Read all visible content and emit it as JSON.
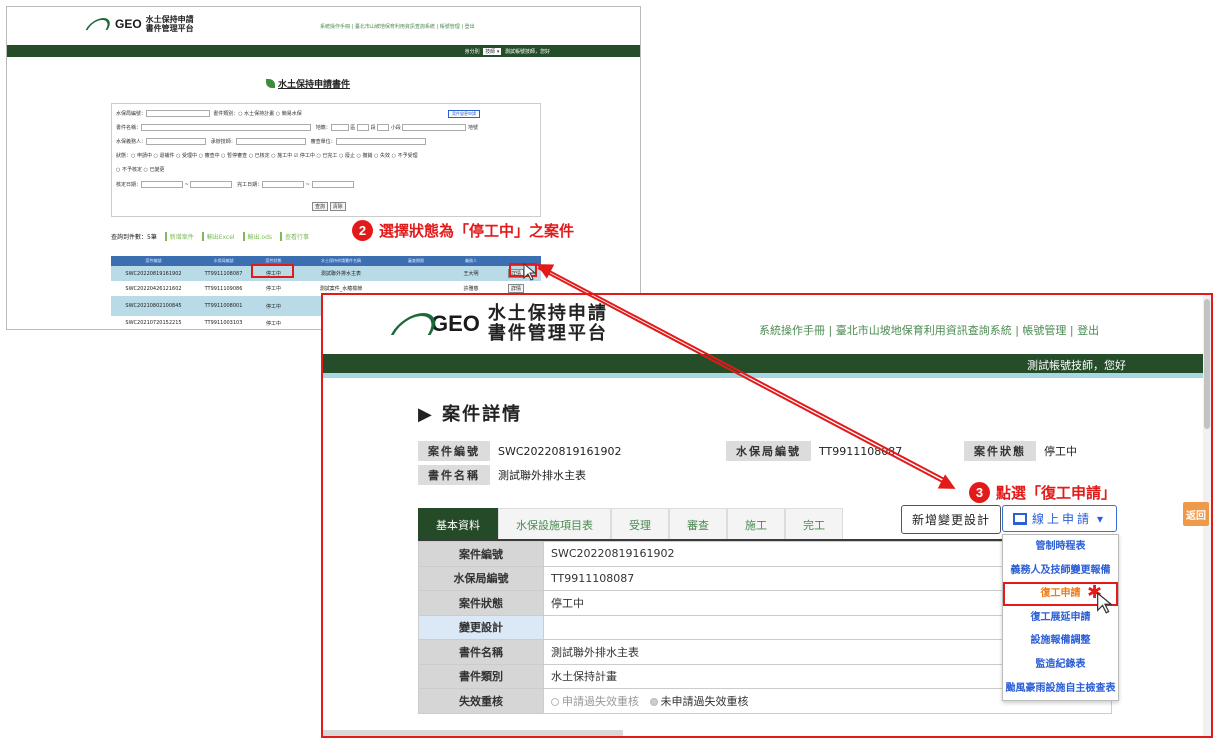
{
  "colors": {
    "annotation_red": "#e21a1a",
    "header_green": "#264d2a",
    "link_blue": "#2b5fd6",
    "accent_orange": "#ef7c14"
  },
  "bg": {
    "logo_text": "GEO",
    "logo_title_1": "水土保持申請",
    "logo_title_2": "書件管理平台",
    "top_links": "系統操作手冊 | 臺北市山坡地保育利用資訊查詢系統 | 帳號管理 | 登出",
    "role_label": "身分別",
    "role_value": "技師",
    "greeting": "測試帳號技師，您好",
    "page_title": "水土保持申請書件",
    "form": {
      "row1": "水保局編號：",
      "row1b": "書件類別：○ 水土保持計畫 ○ 簡易水保",
      "row1c": "案件變更申請",
      "row2": "書件名稱：",
      "row2b": "地籍：",
      "row2c": "區",
      "row2d": "段",
      "row2e": "小段",
      "row2f": "地號",
      "row3": "水保義務人：",
      "row3b": "承辦技師：",
      "row3c": "審查單位：",
      "row4": "狀態：○ 申請中 ○ 退補件 ○ 受理中 ○ 審查中 ○ 暫停審查 ○ 已核定 ○ 施工中 ☑ 停工中 ○ 已完工 ○ 廢止 ○ 撤銷 ○ 失效 ○ 不予受理",
      "row5": "○ 不予核定 ○ 已變更",
      "row6": "核定日期：",
      "row6b": "完工日期：",
      "query": "查詢",
      "clear": "清除"
    },
    "result_count": "查詢到件數：5筆",
    "toolbar": [
      "新增案件",
      "輸出Excel",
      "輸出.ods",
      "查看行事"
    ],
    "table_head": [
      "案件編號",
      "水保局編號",
      "案件狀態",
      "水土保持申請書件名稱",
      "審查期限",
      "義務人"
    ],
    "rows": [
      {
        "id": "SWC20220819161902",
        "no": "TT9911108087",
        "status": "停工中",
        "name": "測試聯外排水主表",
        "person": "王大明",
        "btn": "詳情"
      },
      {
        "id": "SWC20220426121602",
        "no": "TT9911109086",
        "status": "停工中",
        "name": "測試案件_水蘊檢節",
        "person": "許雅慈",
        "btn": "詳情"
      },
      {
        "id": "SWC20210802100845",
        "no": "TT9911008001",
        "status": "停工中",
        "name": "測試",
        "person": "",
        "btn": ""
      },
      {
        "id": "SWC20210720152215",
        "no": "TT9911003103",
        "status": "停工中",
        "name": "",
        "person": "",
        "btn": ""
      }
    ]
  },
  "annotations": {
    "step2_num": "2",
    "step2_text": "選擇狀態為「停工中」之案件",
    "step3_num": "3",
    "step3_text": "點選「復工申請」"
  },
  "fg": {
    "logo_text": "GEO",
    "logo_title_1": "水土保持申請",
    "logo_title_2": "書件管理平台",
    "top_links": "系統操作手冊 | 臺北市山坡地保育利用資訊查詢系統 |   帳號管理   | 登出",
    "greeting": "測試帳號技師，您好",
    "detail_title": "▶ 案件詳情",
    "case_no_label": "案件編號",
    "case_no": "SWC20220819161902",
    "bureau_no_label": "水保局編號",
    "bureau_no": "TT9911108087",
    "status_label": "案件狀態",
    "status": "停工中",
    "doc_name_label": "書件名稱",
    "doc_name": "測試聯外排水主表",
    "tabs": [
      "基本資料",
      "水保設施項目表",
      "受理",
      "審查",
      "施工",
      "完工"
    ],
    "btn_change": "新增變更設計",
    "btn_online": "線上申請",
    "btn_online_caret": "▾",
    "table": [
      {
        "k": "案件編號",
        "v": "SWC20220819161902"
      },
      {
        "k": "水保局編號",
        "v": "TT9911108087"
      },
      {
        "k": "案件狀態",
        "v": "停工中"
      },
      {
        "k": "變更設計",
        "v": ""
      },
      {
        "k": "書件名稱",
        "v": "測試聯外排水主表"
      },
      {
        "k": "書件類別",
        "v": "水土保持計畫"
      },
      {
        "k": "失效重核",
        "v": ""
      }
    ],
    "radio1": "申請過失效重核",
    "radio2": "未申請過失效重核",
    "menu": [
      "管制時程表",
      "義務人及技師變更報備",
      "復工申請",
      "復工展延申請",
      "設施報備調整",
      "監造紀錄表",
      "颱風豪雨設施自主檢查表"
    ],
    "back": "返回"
  }
}
